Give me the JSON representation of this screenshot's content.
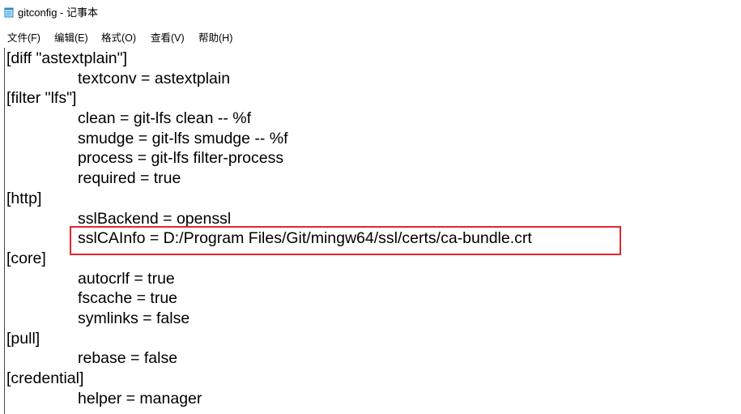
{
  "window": {
    "title": "gitconfig - 记事本",
    "app_icon": "notepad-icon"
  },
  "menu_bar": {
    "items": [
      {
        "label": "文件(F)"
      },
      {
        "label": "编辑(E)"
      },
      {
        "label": "格式(O)"
      },
      {
        "label": "查看(V)"
      },
      {
        "label": "帮助(H)"
      }
    ]
  },
  "editor": {
    "lines": [
      {
        "text": "[diff \"astextplain\"]",
        "indent": 0
      },
      {
        "text": "textconv = astextplain",
        "indent": 1
      },
      {
        "text": "[filter \"lfs\"]",
        "indent": 0
      },
      {
        "text": "clean = git-lfs clean -- %f",
        "indent": 1
      },
      {
        "text": "smudge = git-lfs smudge -- %f",
        "indent": 1
      },
      {
        "text": "process = git-lfs filter-process",
        "indent": 1
      },
      {
        "text": "required = true",
        "indent": 1
      },
      {
        "text": "[http]",
        "indent": 0
      },
      {
        "text": "sslBackend = openssl",
        "indent": 1
      },
      {
        "text": "sslCAInfo = D:/Program Files/Git/mingw64/ssl/certs/ca-bundle.crt",
        "indent": 1,
        "highlighted": true
      },
      {
        "text": "[core]",
        "indent": 0
      },
      {
        "text": "autocrlf = true",
        "indent": 1
      },
      {
        "text": "fscache = true",
        "indent": 1
      },
      {
        "text": "symlinks = false",
        "indent": 1
      },
      {
        "text": "[pull]",
        "indent": 0
      },
      {
        "text": "rebase = false",
        "indent": 1
      },
      {
        "text": "[credential]",
        "indent": 0
      },
      {
        "text": "helper = manager",
        "indent": 1
      }
    ]
  },
  "colors": {
    "highlight_border": "#e3262d"
  }
}
